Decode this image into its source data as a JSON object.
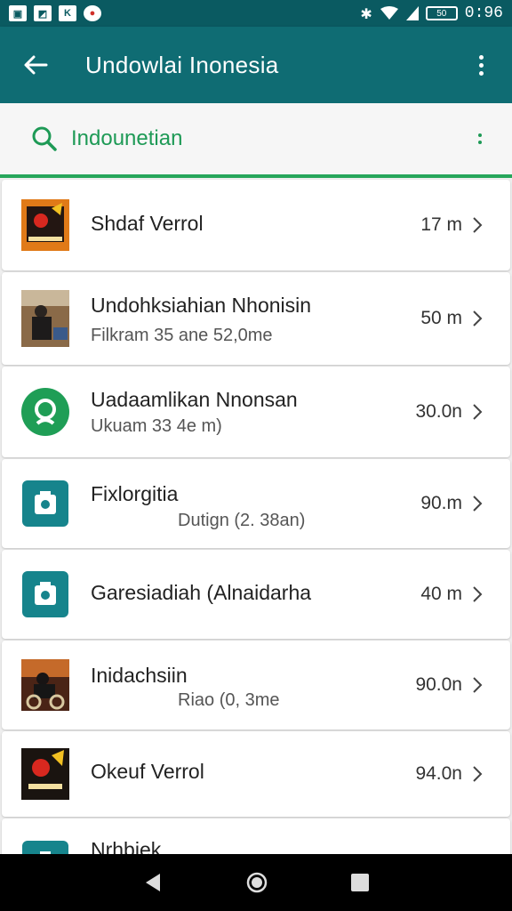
{
  "status_bar": {
    "icons": [
      "image-notification-icon",
      "photo-notification-icon",
      "k-app-icon",
      "record-icon"
    ],
    "battery": "50",
    "time": "0:96"
  },
  "app_bar": {
    "title": "Undowlai Inonesia"
  },
  "search": {
    "value": "Indounetian"
  },
  "list": [
    {
      "title": "Shdaf Verrol",
      "subtitle": "",
      "distance": "17 m",
      "thumb": "poster-thumb"
    },
    {
      "title": "Undohksiahian Nhonisin",
      "subtitle": "Filkram 35 ane 52,0me",
      "distance": "50 m",
      "thumb": "photo-person-thumb"
    },
    {
      "title": "Uadaamlikan Nnonsan",
      "subtitle": "Ukuam 33 4e m)",
      "distance": "30.0n",
      "thumb": "green-search-icon"
    },
    {
      "title": "Fixlorgitia",
      "subtitle": "Dutign (2. 38an)",
      "distance": "90.m",
      "thumb": "camera-icon"
    },
    {
      "title": "Garesiadiah (Alnaidarha",
      "subtitle": "",
      "distance": "40 m",
      "thumb": "camera-icon"
    },
    {
      "title": "Inidachsiin",
      "subtitle": "Riao (0, 3me",
      "distance": "90.0n",
      "thumb": "photo-rider-thumb"
    },
    {
      "title": "Okeuf Verrol",
      "subtitle": "",
      "distance": "94.0n",
      "thumb": "poster-dark-thumb"
    },
    {
      "title": "Nrhbiek",
      "subtitle": "",
      "distance": "",
      "thumb": "camera-icon"
    }
  ],
  "colors": {
    "app_bar": "#0f6c73",
    "status_bar": "#0a5a61",
    "accent": "#26a65b",
    "teal_icon": "#16848c"
  }
}
